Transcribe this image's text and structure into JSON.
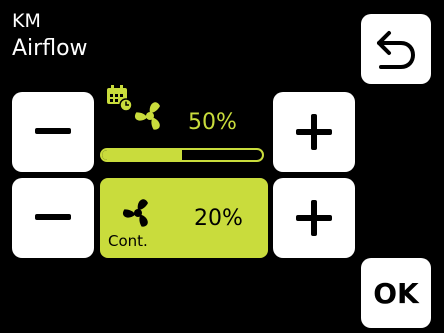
{
  "header": {
    "line1": "KM",
    "line2": "Airflow"
  },
  "buttons": {
    "back_icon": "back-arrow-icon",
    "ok_label": "OK",
    "minus_icon": "minus-icon",
    "plus_icon": "plus-icon"
  },
  "scheduled": {
    "icon": "calendar-fan-icon",
    "percent_label": "50%",
    "percent_value": 50
  },
  "continuous": {
    "icon": "fan-icon",
    "label": "Cont.",
    "percent_label": "20%"
  },
  "colors": {
    "background": "#000000",
    "accent": "#c9dc3c",
    "button": "#ffffff"
  }
}
